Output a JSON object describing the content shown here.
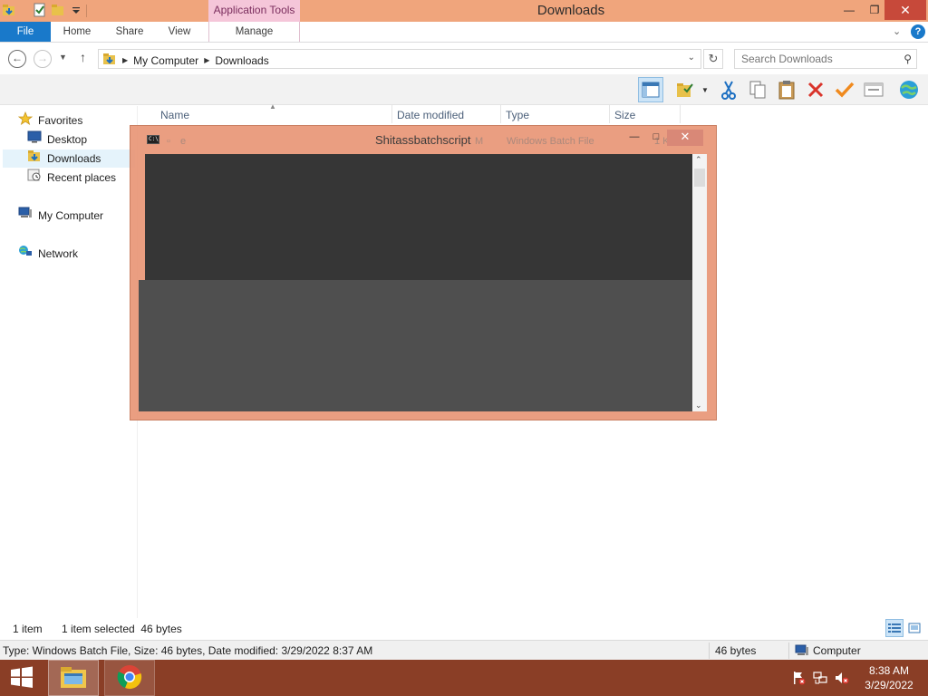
{
  "window": {
    "title": "Downloads",
    "minimize": "—",
    "maximize": "❐",
    "close": "✕"
  },
  "ribbon": {
    "context_tab": "Application Tools",
    "tabs": {
      "file": "File",
      "home": "Home",
      "share": "Share",
      "view": "View",
      "manage": "Manage"
    },
    "expand": "⌄",
    "help": "?"
  },
  "address": {
    "crumbs": [
      "My Computer",
      "Downloads"
    ],
    "dropdown": "⌄",
    "refresh": "↻"
  },
  "search": {
    "placeholder": "Search Downloads"
  },
  "nav_pane": {
    "favorites": "Favorites",
    "desktop": "Desktop",
    "downloads": "Downloads",
    "recent": "Recent places",
    "computer": "My Computer",
    "network": "Network"
  },
  "columns": {
    "name": "Name",
    "date_modified": "Date modified",
    "type": "Type",
    "size": "Size"
  },
  "batch_window": {
    "title": "Shitassbatchscript",
    "ghost_name": "e",
    "ghost_date": "M",
    "ghost_type": "Windows Batch File",
    "ghost_size": "1 KB",
    "minimize": "—",
    "maximize": "□",
    "close": "✕"
  },
  "status": {
    "count": "1 item",
    "selection": "1 item selected  46 bytes"
  },
  "details": {
    "info": "Type: Windows Batch File, Size: 46 bytes, Date modified: 3/29/2022 8:37 AM",
    "size": "46 bytes",
    "location": "Computer"
  },
  "taskbar": {
    "time": "8:38 AM",
    "date": "3/29/2022"
  },
  "colors": {
    "title_bar": "#f0a57c",
    "file_tab": "#1979ca",
    "taskbar": "#8a3e26",
    "close_button": "#c7493a"
  }
}
